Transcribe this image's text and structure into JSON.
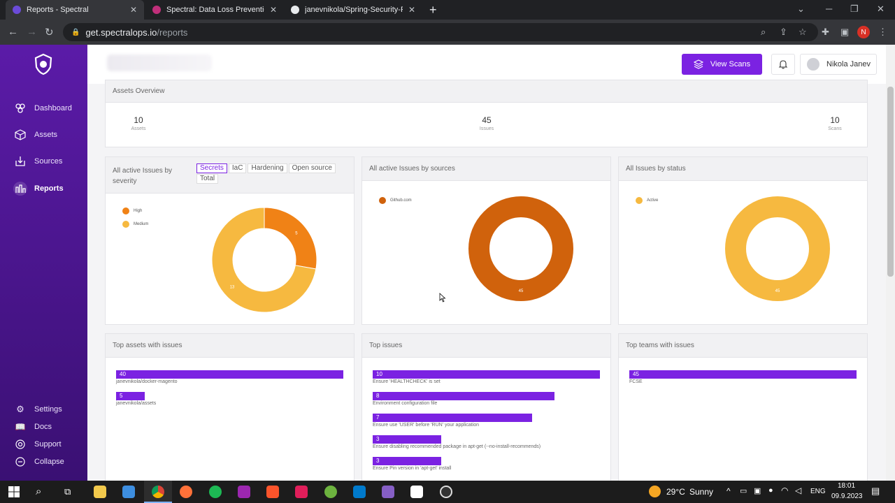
{
  "browser": {
    "tabs": [
      {
        "title": "Reports - Spectral",
        "active": true,
        "favicon_color": "#6b4bd8"
      },
      {
        "title": "Spectral: Data Loss Prevention So",
        "active": false,
        "favicon_color": "#c02f7a"
      },
      {
        "title": "janevnikola/Spring-Security-Full-",
        "active": false,
        "favicon_color": "#e8eaed"
      }
    ],
    "url_host": "get.spectralops.io",
    "url_path": "/reports",
    "profile_initial": "N"
  },
  "sidebar": {
    "items": [
      {
        "label": "Dashboard",
        "icon": "dashboard-icon"
      },
      {
        "label": "Assets",
        "icon": "cube-icon"
      },
      {
        "label": "Sources",
        "icon": "box-download-icon"
      },
      {
        "label": "Reports",
        "icon": "reports-icon",
        "active": true
      }
    ],
    "bottom": [
      {
        "label": "Settings",
        "icon": "gear-icon"
      },
      {
        "label": "Docs",
        "icon": "book-icon"
      },
      {
        "label": "Support",
        "icon": "help-icon"
      },
      {
        "label": "Collapse",
        "icon": "collapse-icon"
      }
    ]
  },
  "topbar": {
    "view_scans_label": "View Scans",
    "user_name": "Nikola Janev"
  },
  "assets_overview": {
    "title": "Assets Overview",
    "stats": [
      {
        "value": "10",
        "label": "Assets"
      },
      {
        "value": "45",
        "label": "Issues"
      },
      {
        "value": "10",
        "label": "Scans"
      }
    ]
  },
  "severity_card": {
    "title": "All active Issues by severity",
    "filters": [
      "Secrets",
      "IaC",
      "Hardening",
      "Open source",
      "Total"
    ],
    "selected_filter": "Secrets"
  },
  "sources_card": {
    "title": "All active Issues by sources"
  },
  "status_card": {
    "title": "All Issues by status"
  },
  "top_assets": {
    "title": "Top assets with issues",
    "items": [
      {
        "value": 40,
        "label": "janevnikola/docker-magento"
      },
      {
        "value": 5,
        "label": "janevnikola/assets"
      }
    ]
  },
  "top_issues": {
    "title": "Top issues",
    "items": [
      {
        "value": 10,
        "label": "Ensure 'HEALTHCHECK' is set"
      },
      {
        "value": 8,
        "label": "Environment configuration file"
      },
      {
        "value": 7,
        "label": "Ensure use 'USER' before 'RUN' your application"
      },
      {
        "value": 3,
        "label": "Ensure disabling recommended package in apt-get (--no-install-recommends)"
      },
      {
        "value": 3,
        "label": "Ensure Pin version in 'apt-get' install"
      }
    ]
  },
  "top_teams": {
    "title": "Top teams with issues",
    "items": [
      {
        "value": 45,
        "label": "FCSE"
      }
    ]
  },
  "chart_data": [
    {
      "type": "pie",
      "categories": [
        "High",
        "Medium"
      ],
      "values": [
        5,
        13
      ],
      "colors": [
        "#f08216",
        "#f6b940"
      ],
      "legend": "top-left"
    },
    {
      "type": "pie",
      "categories": [
        "Github.com"
      ],
      "values": [
        45
      ],
      "colors": [
        "#d0620c"
      ],
      "legend": "top-left"
    },
    {
      "type": "pie",
      "categories": [
        "Active"
      ],
      "values": [
        45
      ],
      "colors": [
        "#f6b940"
      ],
      "legend": "top-left"
    }
  ],
  "taskbar": {
    "weather_temp": "29°C",
    "weather_text": "Sunny",
    "lang": "ENG",
    "time": "18:01",
    "date": "09.9.2023"
  }
}
